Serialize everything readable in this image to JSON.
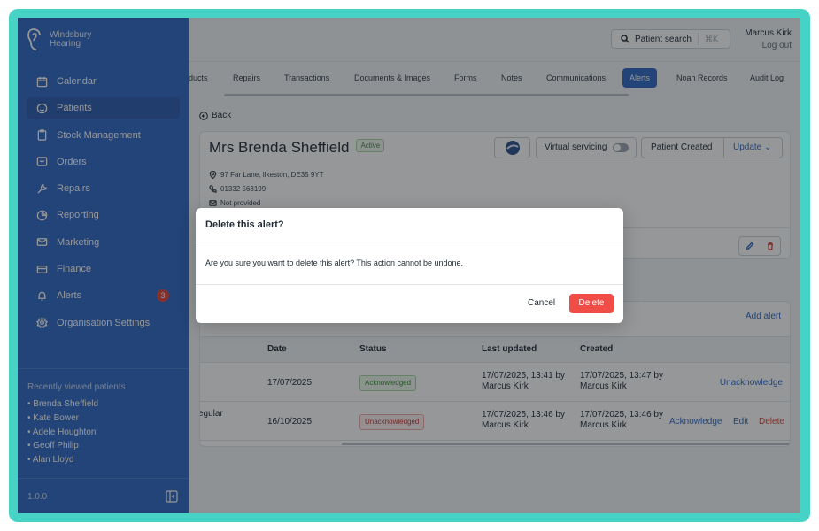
{
  "brand": {
    "name_line1": "Windsbury",
    "name_line2": "Hearing"
  },
  "nav": [
    {
      "label": "Calendar",
      "icon": "calendar-icon"
    },
    {
      "label": "Patients",
      "icon": "smiley-icon",
      "active": true
    },
    {
      "label": "Stock Management",
      "icon": "clipboard-icon"
    },
    {
      "label": "Orders",
      "icon": "inbox-icon"
    },
    {
      "label": "Repairs",
      "icon": "wrench-icon"
    },
    {
      "label": "Reporting",
      "icon": "pie-chart-icon"
    },
    {
      "label": "Marketing",
      "icon": "mail-icon"
    },
    {
      "label": "Finance",
      "icon": "card-icon"
    },
    {
      "label": "Alerts",
      "icon": "bell-icon",
      "badge": "3"
    },
    {
      "label": "Organisation Settings",
      "icon": "gear-icon"
    }
  ],
  "recent": {
    "title": "Recently viewed patients",
    "items": [
      "• Brenda Sheffield",
      "• Kate Bower",
      "• Adele Houghton",
      "• Geoff Philip",
      "• Alan Lloyd"
    ]
  },
  "version": "1.0.0",
  "header": {
    "search_label": "Patient search",
    "search_shortcut": "⌘K",
    "user_name": "Marcus Kirk",
    "logout": "Log out"
  },
  "tabs": [
    "ducts",
    "Repairs",
    "Transactions",
    "Documents & Images",
    "Forms",
    "Notes",
    "Communications",
    "Alerts",
    "Noah Records",
    "Audit Log"
  ],
  "back": "Back",
  "patient": {
    "name": "Mrs Brenda Sheffield",
    "status": "Active",
    "address": "97 Far Lane, Ilkeston, DE35 9YT",
    "phone": "01332 563199",
    "email": "Not provided",
    "virtual_servicing": "Virtual servicing",
    "created_label": "Patient Created",
    "update_label": "Update"
  },
  "alerts": {
    "add": "Add alert",
    "columns": [
      "Date",
      "Status",
      "Last updated",
      "Created"
    ],
    "rows": [
      {
        "title": "",
        "date": "17/07/2025",
        "status": "Acknowledged",
        "last_updated_1": "17/07/2025, 13:41 by",
        "last_updated_2": "Marcus Kirk",
        "created_1": "17/07/2025, 13:47 by",
        "created_2": "Marcus Kirk",
        "action1": "Unacknowledge"
      },
      {
        "title": "egular",
        "date": "16/10/2025",
        "status": "Unacknowledged",
        "last_updated_1": "17/07/2025, 13:46 by",
        "last_updated_2": "Marcus Kirk",
        "created_1": "17/07/2025, 13:46 by",
        "created_2": "Marcus Kirk",
        "action1": "Acknowledge",
        "action2": "Edit",
        "action3": "Delete"
      }
    ]
  },
  "modal": {
    "title": "Delete this alert?",
    "body": "Are you sure you want to delete this alert? This action cannot be undone.",
    "cancel": "Cancel",
    "confirm": "Delete"
  },
  "colors": {
    "sidebar": "#3168c3",
    "accent": "#3168c3",
    "danger": "#f04d47",
    "frame": "#46d3c6"
  }
}
